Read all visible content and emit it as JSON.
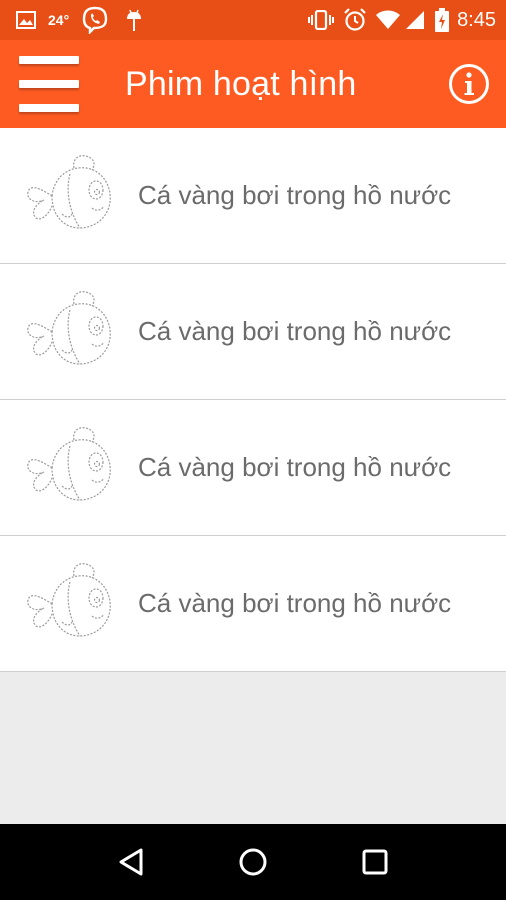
{
  "status_bar": {
    "temperature": "24°",
    "time": "8:45",
    "icons": [
      "image-icon",
      "viber-icon",
      "android-icon",
      "vibrate-icon",
      "alarm-icon",
      "wifi-icon",
      "signal-icon",
      "battery-charging-icon"
    ]
  },
  "app_bar": {
    "title": "Phim hoạt hình",
    "icons": [
      "menu-icon",
      "info-icon"
    ]
  },
  "list": {
    "items": [
      {
        "title": "Cá vàng bơi trong hồ nước",
        "icon": "fish-drawing-icon"
      },
      {
        "title": "Cá vàng bơi trong hồ nước",
        "icon": "fish-drawing-icon"
      },
      {
        "title": "Cá vàng bơi trong hồ nước",
        "icon": "fish-drawing-icon"
      },
      {
        "title": "Cá vàng bơi trong hồ nước",
        "icon": "fish-drawing-icon"
      }
    ]
  },
  "nav_bar": {
    "icons": [
      "back-icon",
      "home-icon",
      "recents-icon"
    ]
  },
  "colors": {
    "status_bar": "#e84f16",
    "app_bar": "#fe5b23",
    "background": "#ececec",
    "item_text": "#6b6b6b"
  }
}
